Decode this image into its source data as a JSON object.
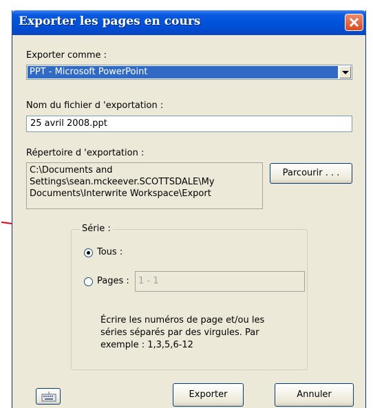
{
  "window": {
    "title": "Exporter les pages en cours"
  },
  "export_as": {
    "label": "Exporter comme :",
    "selected": "PPT - Microsoft PowerPoint"
  },
  "file_name": {
    "label": "Nom du fichier d 'exportation :",
    "value": "25 avril 2008.ppt"
  },
  "directory": {
    "label": "Répertoire d 'exportation :",
    "lines": [
      "C:\\Documents and",
      "Settings\\sean.mckeever.SCOTTSDALE\\My",
      "Documents\\Interwrite Workspace\\Export"
    ],
    "browse_label": "Parcourir . . ."
  },
  "series": {
    "legend": "Série :",
    "all_label": "Tous :",
    "all_checked": true,
    "pages_label": "Pages :",
    "pages_checked": false,
    "pages_value": "1 - 1",
    "help_lines": [
      "Écrire les numéros de page et/ou les",
      "séries séparés par des virgules. Par",
      "exemple :  1,3,5,6-12"
    ]
  },
  "buttons": {
    "export_label": "Exporter",
    "cancel_label": "Annuler"
  },
  "icons": {
    "close": "close-icon",
    "keyboard": "keyboard-icon",
    "annotation": "red-arrow-icon"
  },
  "colors": {
    "titlebar": "#0a5ae0",
    "selection": "#316ac5",
    "close": "#d84a24",
    "annotation_arrow": "#e0001b"
  }
}
